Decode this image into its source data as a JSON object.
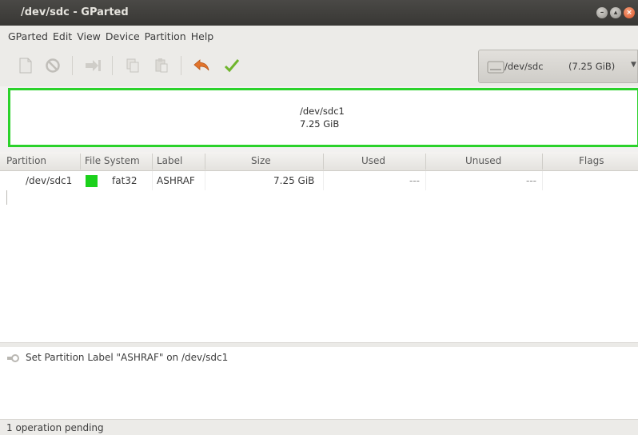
{
  "window": {
    "title": "/dev/sdc - GParted"
  },
  "menu": [
    "GParted",
    "Edit",
    "View",
    "Device",
    "Partition",
    "Help"
  ],
  "toolbar": {
    "icons": [
      "new-partition-icon",
      "delete-icon",
      "resize-move-icon",
      "copy-icon",
      "paste-icon",
      "undo-icon",
      "apply-icon"
    ]
  },
  "device": {
    "name": "/dev/sdc",
    "size": "(7.25 GiB)"
  },
  "graphic": {
    "name": "/dev/sdc1",
    "size": "7.25 GiB",
    "color": "#2bd22b"
  },
  "table": {
    "headers": [
      "Partition",
      "File System",
      "Label",
      "Size",
      "Used",
      "Unused",
      "Flags"
    ],
    "rows": [
      {
        "partition": "/dev/sdc1",
        "fs_color": "#1bd11b",
        "filesystem": "fat32",
        "label": "ASHRAF",
        "size": "7.25 GiB",
        "used": "---",
        "unused": "---",
        "flags": ""
      }
    ]
  },
  "operations": [
    "Set Partition Label \"ASHRAF\" on /dev/sdc1"
  ],
  "status": "1 operation pending"
}
